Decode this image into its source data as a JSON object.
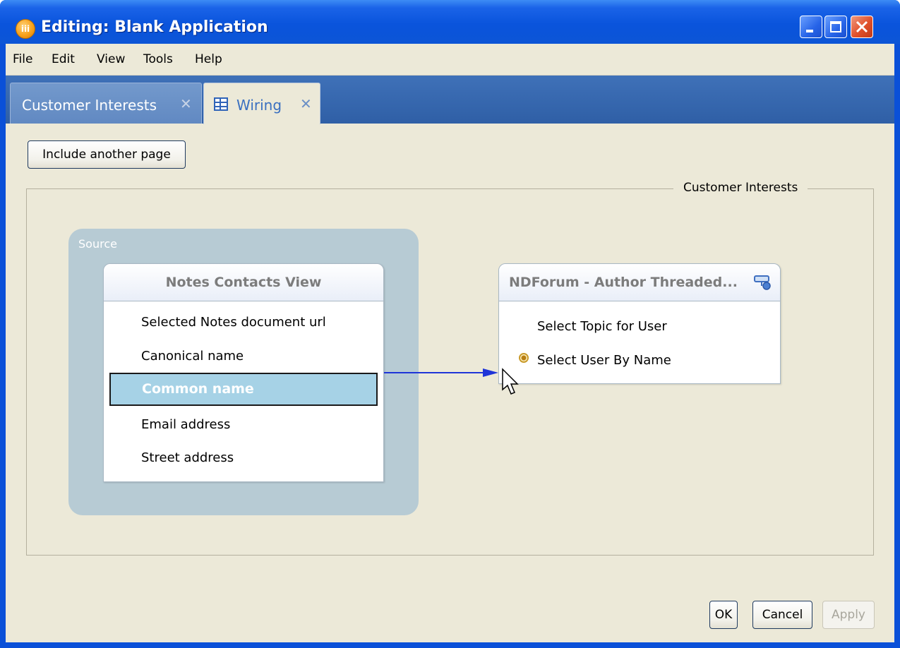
{
  "window": {
    "title": "Editing: Blank Application",
    "app_icon": "app-logo-icon"
  },
  "menu": [
    "File",
    "Edit",
    "View",
    "Tools",
    "Help"
  ],
  "tabs": [
    {
      "label": "Customer Interests",
      "active": false,
      "close": "✕"
    },
    {
      "label": "Wiring",
      "active": true,
      "close": "✕",
      "icon": "table-icon"
    }
  ],
  "toolbar": {
    "include_page_label": "Include another page"
  },
  "group": {
    "title": "Customer Interests"
  },
  "source": {
    "label": "Source",
    "card": {
      "title": "Notes Contacts View",
      "rows": [
        "Selected Notes document url",
        "Canonical name",
        "Common name",
        "Email address",
        "Street address"
      ],
      "selected_index": 2
    }
  },
  "target": {
    "card": {
      "title": "NDForum - Author Threaded...",
      "rows": [
        "Select Topic for User",
        "Select User By Name"
      ],
      "connected_index": 1
    }
  },
  "wire_color": "#1f35d8",
  "buttons": {
    "ok": "OK",
    "cancel": "Cancel",
    "apply": "Apply"
  }
}
